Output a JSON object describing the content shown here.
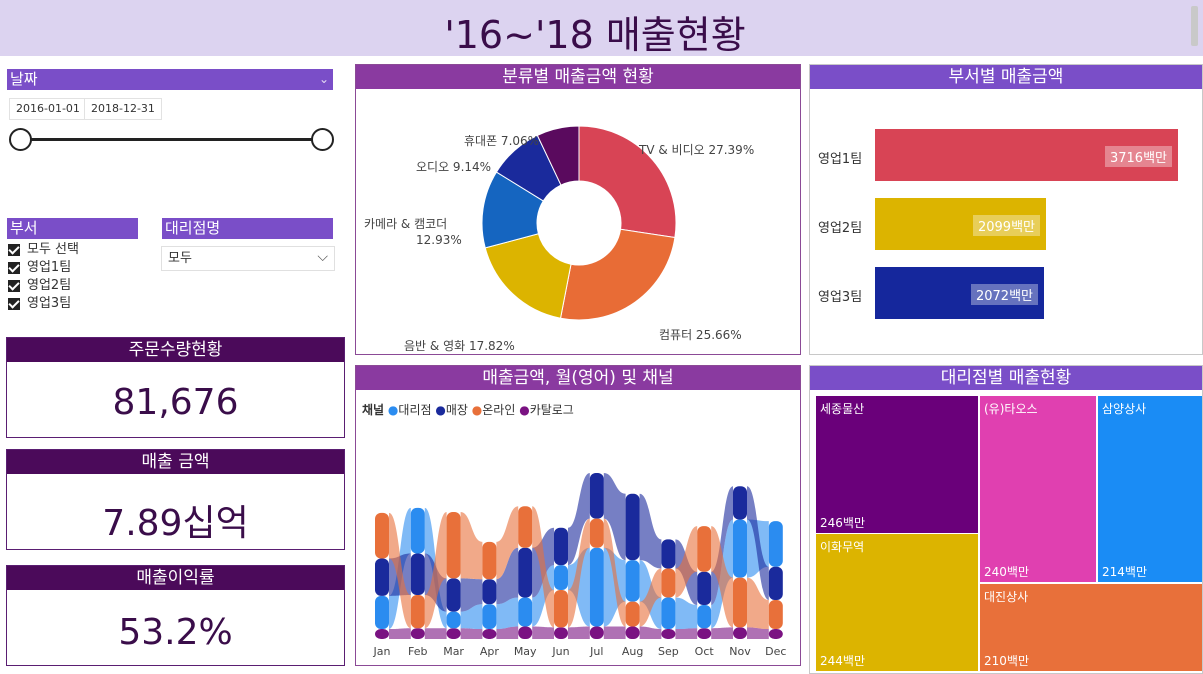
{
  "title": "'16~'18 매출현황",
  "date_slicer": {
    "header": "날짜",
    "start": "2016-01-01",
    "end": "2018-12-31"
  },
  "dept_slicer": {
    "header": "부서",
    "items": [
      "모두 선택",
      "영업1팀",
      "영업2팀",
      "영업3팀"
    ]
  },
  "branch_slicer": {
    "header": "대리점명",
    "value": "모두"
  },
  "kpis": [
    {
      "title": "주문수량현황",
      "value": "81,676"
    },
    {
      "title": "매출 금액",
      "value": "7.89십억"
    },
    {
      "title": "매출이익률",
      "value": "53.2%"
    }
  ],
  "donut": {
    "title": "분류별 매출금액 현황",
    "slices": [
      {
        "name": "TV & 비디오",
        "value": 27.39,
        "label": "TV & 비디오 27.39%",
        "color": "#d84455"
      },
      {
        "name": "컴퓨터",
        "value": 25.66,
        "label": "컴퓨터 25.66%",
        "color": "#e86c36"
      },
      {
        "name": "음반 & 영화",
        "value": 17.82,
        "label": "음반 & 영화 17.82%",
        "color": "#dcb400"
      },
      {
        "name": "카메라 & 캠코더",
        "value": 12.93,
        "label1": "카메라 & 캠코더",
        "label2": "12.93%",
        "color": "#1565c0"
      },
      {
        "name": "오디오",
        "value": 9.14,
        "label": "오디오 9.14%",
        "color": "#1a2a9c"
      },
      {
        "name": "휴대폰",
        "value": 7.06,
        "label": "휴대폰 7.06%",
        "color": "#5a0a5e"
      }
    ]
  },
  "dept_bars": {
    "title": "부서별 매출금액",
    "items": [
      {
        "name": "영업1팀",
        "value": 3716,
        "label": "3716백만",
        "color": "#d84455"
      },
      {
        "name": "영업2팀",
        "value": 2099,
        "label": "2099백만",
        "color": "#dcb400"
      },
      {
        "name": "영업3팀",
        "value": 2072,
        "label": "2072백만",
        "color": "#15279c"
      }
    ]
  },
  "ribbon": {
    "title": "매출금액, 월(영어) 및 채널",
    "legend_title": "채널",
    "legend": [
      {
        "name": "대리점",
        "color": "#2b8cf0"
      },
      {
        "name": "매장",
        "color": "#1a2a9c"
      },
      {
        "name": "온라인",
        "color": "#e8703a"
      },
      {
        "name": "카탈로그",
        "color": "#7a1282"
      }
    ],
    "months": [
      "Jan",
      "Feb",
      "Mar",
      "Apr",
      "May",
      "Jun",
      "Jul",
      "Aug",
      "Sep",
      "Oct",
      "Nov",
      "Dec"
    ]
  },
  "chart_data": {
    "type": "area",
    "x": [
      "Jan",
      "Feb",
      "Mar",
      "Apr",
      "May",
      "Jun",
      "Jul",
      "Aug",
      "Sep",
      "Oct",
      "Nov",
      "Dec"
    ],
    "series": [
      {
        "name": "카탈로그",
        "values": [
          12,
          13,
          13,
          12,
          15,
          14,
          15,
          15,
          12,
          13,
          14,
          12
        ]
      },
      {
        "name": "대리점",
        "values": [
          40,
          55,
          20,
          30,
          35,
          30,
          95,
          50,
          38,
          28,
          70,
          55
        ]
      },
      {
        "name": "매장",
        "values": [
          45,
          50,
          40,
          30,
          60,
          45,
          55,
          80,
          35,
          40,
          40,
          40
        ]
      },
      {
        "name": "온라인",
        "values": [
          55,
          40,
          80,
          45,
          50,
          45,
          35,
          30,
          35,
          55,
          60,
          35
        ]
      }
    ],
    "order": [
      [
        "카탈로그",
        "대리점",
        "매장",
        "온라인"
      ],
      [
        "카탈로그",
        "온라인",
        "매장",
        "대리점"
      ],
      [
        "카탈로그",
        "대리점",
        "매장",
        "온라인"
      ],
      [
        "카탈로그",
        "대리점",
        "매장",
        "온라인"
      ],
      [
        "카탈로그",
        "대리점",
        "매장",
        "온라인"
      ],
      [
        "카탈로그",
        "온라인",
        "대리점",
        "매장"
      ],
      [
        "카탈로그",
        "대리점",
        "온라인",
        "매장"
      ],
      [
        "카탈로그",
        "온라인",
        "대리점",
        "매장"
      ],
      [
        "카탈로그",
        "대리점",
        "온라인",
        "매장"
      ],
      [
        "카탈로그",
        "대리점",
        "매장",
        "온라인"
      ],
      [
        "카탈로그",
        "온라인",
        "대리점",
        "매장"
      ],
      [
        "카탈로그",
        "온라인",
        "매장",
        "대리점"
      ]
    ]
  },
  "treemap": {
    "title": "대리점별 매출현황",
    "items": [
      {
        "name": "세종물산",
        "value": "246백만",
        "color": "#6a007a"
      },
      {
        "name": "이화무역",
        "value": "244백만",
        "color": "#dcb400"
      },
      {
        "name": "(유)타오스",
        "value": "240백만",
        "color": "#e040b0"
      },
      {
        "name": "삼양상사",
        "value": "214백만",
        "color": "#1a8cf5"
      },
      {
        "name": "대진상사",
        "value": "210백만",
        "color": "#e8703a"
      }
    ]
  }
}
